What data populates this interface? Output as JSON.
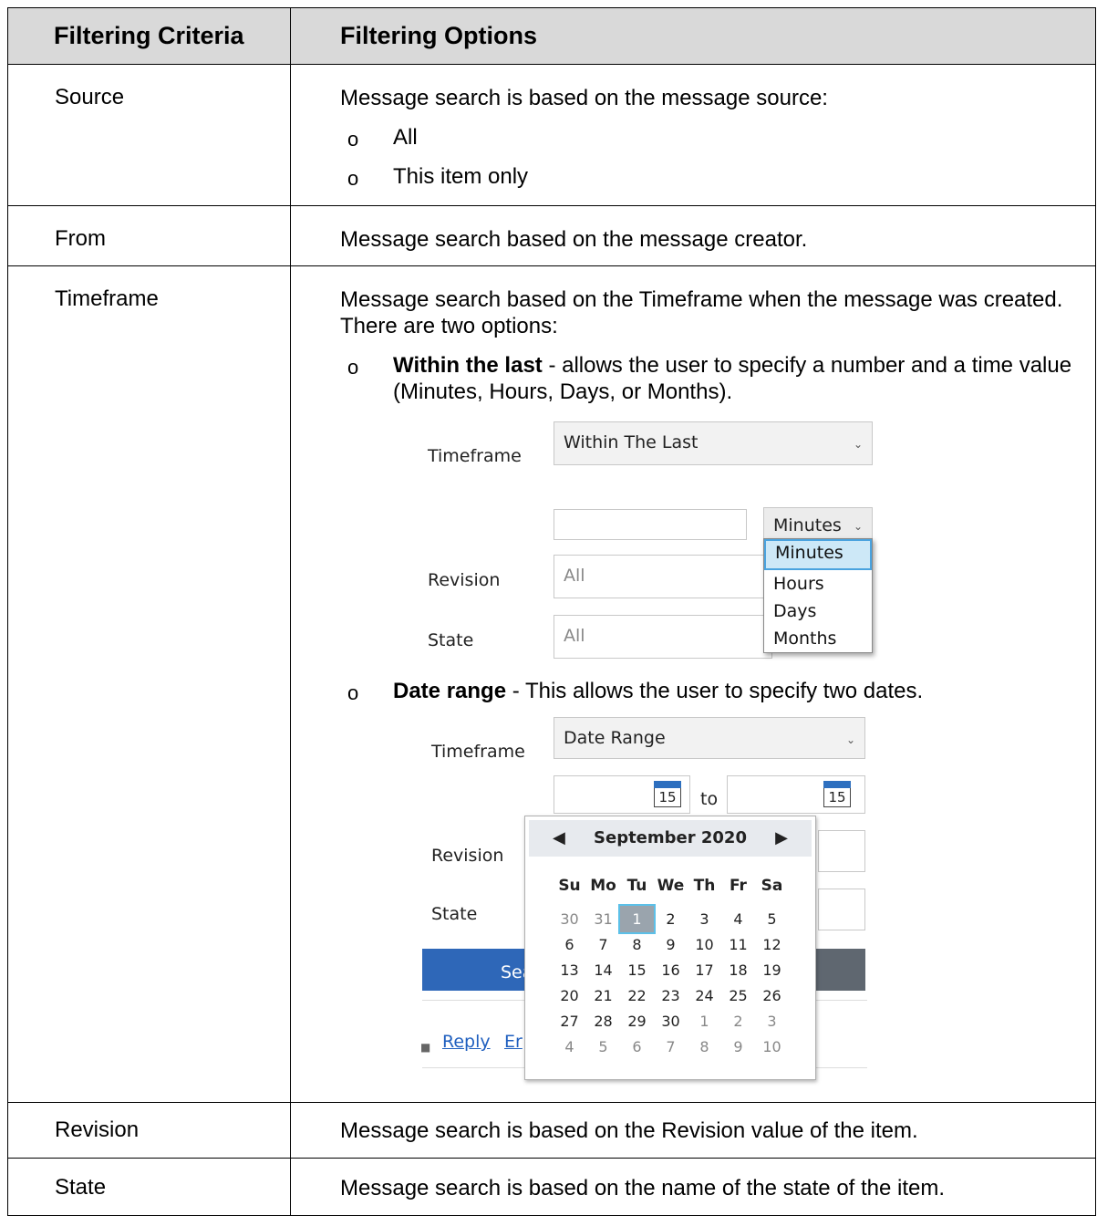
{
  "header": {
    "col1": "Filtering Criteria",
    "col2": "Filtering Options"
  },
  "rows": {
    "source": {
      "criteria": "Source",
      "text": "Message search is based on the message source:",
      "options": [
        "All",
        "This item only"
      ]
    },
    "from": {
      "criteria": "From",
      "text": "Message search based on the message creator."
    },
    "timeframe": {
      "criteria": "Timeframe",
      "text": "Message search based on the Timeframe when the message was created. There are two options:",
      "opt1_bold": "Within the last",
      "opt1_rest": " - allows the user to specify a number and a time value (Minutes, Hours, Days, or Months).",
      "opt2_bold": "Date range",
      "opt2_rest": " - This allows the user to specify two dates."
    },
    "revision": {
      "criteria": "Revision",
      "text": "Message search is based on the Revision value of the item."
    },
    "state": {
      "criteria": "State",
      "text": "Message search is based on the name of the state of the item."
    }
  },
  "shot1": {
    "timeframe_label": "Timeframe",
    "timeframe_value": "Within The Last",
    "unit_value": "Minutes",
    "unit_options": [
      "Minutes",
      "Hours",
      "Days",
      "Months"
    ],
    "revision_label": "Revision",
    "revision_value": "All",
    "state_label": "State",
    "state_value": "All"
  },
  "shot2": {
    "timeframe_label": "Timeframe",
    "timeframe_value": "Date Range",
    "to_label": "to",
    "calendar_icon_day": "15",
    "revision_label": "Revision",
    "state_label": "State",
    "search_partial": "Sea",
    "reply_link": "Reply",
    "partial_link": "Er",
    "calendar": {
      "month": "September 2020",
      "dow": [
        "Su",
        "Mo",
        "Tu",
        "We",
        "Th",
        "Fr",
        "Sa"
      ],
      "weeks": [
        [
          "30",
          "31",
          "1",
          "2",
          "3",
          "4",
          "5"
        ],
        [
          "6",
          "7",
          "8",
          "9",
          "10",
          "11",
          "12"
        ],
        [
          "13",
          "14",
          "15",
          "16",
          "17",
          "18",
          "19"
        ],
        [
          "20",
          "21",
          "22",
          "23",
          "24",
          "25",
          "26"
        ],
        [
          "27",
          "28",
          "29",
          "30",
          "1",
          "2",
          "3"
        ],
        [
          "4",
          "5",
          "6",
          "7",
          "8",
          "9",
          "10"
        ]
      ],
      "selected": "1"
    }
  }
}
